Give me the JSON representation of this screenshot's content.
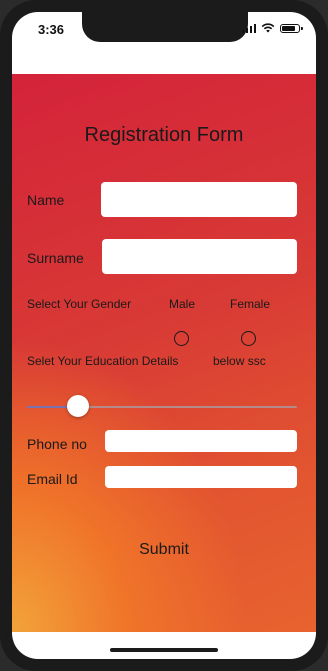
{
  "status_bar": {
    "time": "3:36",
    "battery_level": 0.85
  },
  "form": {
    "title": "Registration Form",
    "name_label": "Name",
    "name_value": "",
    "surname_label": "Surname",
    "surname_value": "",
    "gender_label": "Select Your Gender",
    "gender_options": [
      {
        "label": "Male",
        "selected": false
      },
      {
        "label": "Female",
        "selected": false
      }
    ],
    "education_label": "Selet Your Education Details",
    "education_value": "below ssc",
    "education_slider_value": 0.19,
    "phone_label": "Phone no",
    "phone_value": "",
    "email_label": "Email Id",
    "email_value": "",
    "submit_label": "Submit"
  },
  "colors": {
    "gradient_top": "#d4233a",
    "gradient_bottom_left": "#f2a33a",
    "gradient_bottom_right": "#e8632f",
    "slider_fill": "#7a72b0"
  }
}
